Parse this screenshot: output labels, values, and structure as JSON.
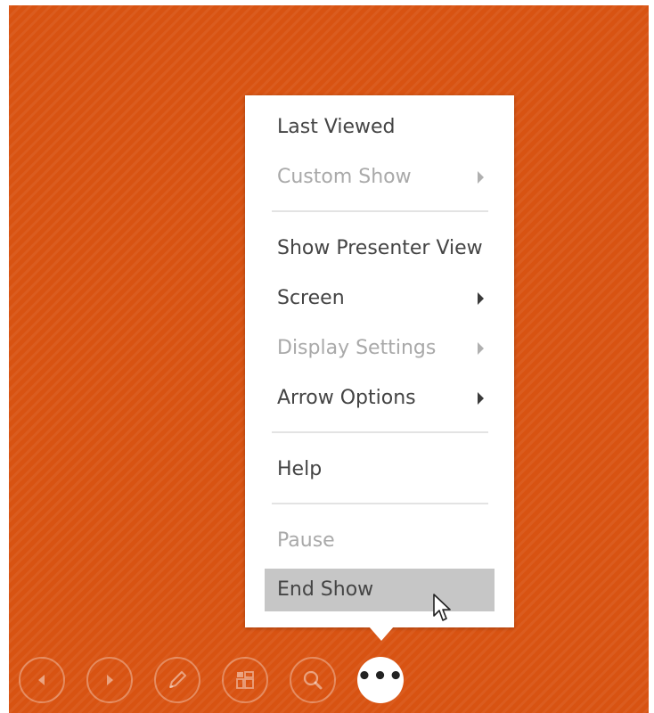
{
  "menu": {
    "items": [
      {
        "label": "Last Viewed",
        "enabled": true,
        "submenu": false
      },
      {
        "label": "Custom Show",
        "enabled": false,
        "submenu": true
      },
      {
        "label": "Show Presenter View",
        "enabled": true,
        "submenu": false
      },
      {
        "label": "Screen",
        "enabled": true,
        "submenu": true
      },
      {
        "label": "Display Settings",
        "enabled": false,
        "submenu": true
      },
      {
        "label": "Arrow Options",
        "enabled": true,
        "submenu": true
      },
      {
        "label": "Help",
        "enabled": true,
        "submenu": false
      },
      {
        "label": "Pause",
        "enabled": false,
        "submenu": false
      },
      {
        "label": "End Show",
        "enabled": true,
        "submenu": false,
        "hovered": true
      }
    ]
  },
  "toolbar": {
    "buttons": [
      {
        "icon": "previous-slide-icon"
      },
      {
        "icon": "next-slide-icon"
      },
      {
        "icon": "pen-icon"
      },
      {
        "icon": "see-all-slides-icon"
      },
      {
        "icon": "zoom-icon"
      },
      {
        "icon": "more-options-icon",
        "glyph": "•••",
        "active": true
      }
    ]
  },
  "colors": {
    "slide_background": "#d85312",
    "menu_background": "#ffffff",
    "menu_text": "#444444",
    "menu_text_disabled": "#a9a9a9",
    "hover_highlight": "#c6c6c6"
  }
}
